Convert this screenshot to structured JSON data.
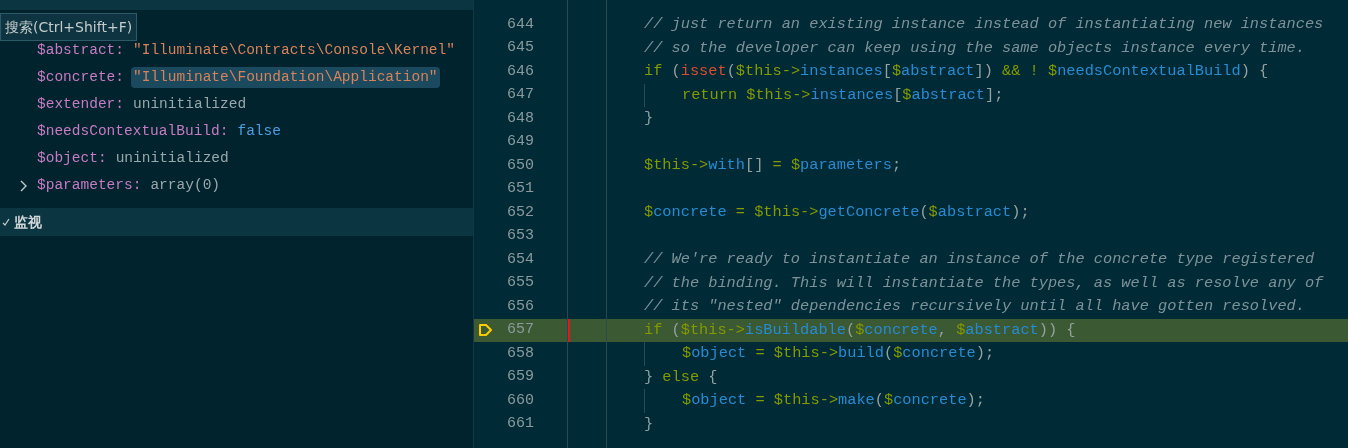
{
  "tooltip": {
    "text": "搜索(Ctrl+Shift+F)"
  },
  "variables": [
    {
      "name": "$abstract:",
      "value": "\"Illuminate\\Contracts\\Console\\Kernel\"",
      "kind": "string",
      "selected": false
    },
    {
      "name": "$concrete:",
      "value": "\"Illuminate\\Foundation\\Application\"",
      "kind": "string",
      "selected": true
    },
    {
      "name": "$extender:",
      "value": "uninitialized",
      "kind": "plain",
      "selected": false
    },
    {
      "name": "$needsContextualBuild:",
      "value": "false",
      "kind": "boolean",
      "selected": false
    },
    {
      "name": "$object:",
      "value": "uninitialized",
      "kind": "plain",
      "selected": false
    },
    {
      "name": "$parameters:",
      "value": "array(0)",
      "kind": "plain",
      "selected": false,
      "expanded": false
    }
  ],
  "watch_section": {
    "title": "监视",
    "expanded": true
  },
  "editor": {
    "lines": [
      {
        "number": "644",
        "nested": false,
        "current": false,
        "tokens": [
          {
            "kind": "comment",
            "text": "// just return an existing instance instead of instantiating new instances"
          }
        ]
      },
      {
        "number": "645",
        "nested": false,
        "current": false,
        "tokens": [
          {
            "kind": "comment",
            "text": "// so the developer can keep using the same objects instance every time."
          }
        ]
      },
      {
        "number": "646",
        "nested": false,
        "current": false,
        "tokens": [
          {
            "kind": "kw",
            "text": "if"
          },
          {
            "kind": "op",
            "text": " ("
          },
          {
            "kind": "builtin",
            "text": "isset"
          },
          {
            "kind": "op",
            "text": "("
          },
          {
            "kind": "kw",
            "text": "$this->"
          },
          {
            "kind": "fn",
            "text": "instances"
          },
          {
            "kind": "op",
            "text": "["
          },
          {
            "kind": "kw",
            "text": "$"
          },
          {
            "kind": "fn",
            "text": "abstract"
          },
          {
            "kind": "op",
            "text": "]) "
          },
          {
            "kind": "kw",
            "text": "&& ! $"
          },
          {
            "kind": "fn",
            "text": "needsContextualBuild"
          },
          {
            "kind": "op",
            "text": ") {"
          }
        ]
      },
      {
        "number": "647",
        "nested": true,
        "current": false,
        "tokens": [
          {
            "kind": "kw",
            "text": "return $this->"
          },
          {
            "kind": "fn",
            "text": "instances"
          },
          {
            "kind": "op",
            "text": "["
          },
          {
            "kind": "kw",
            "text": "$"
          },
          {
            "kind": "fn",
            "text": "abstract"
          },
          {
            "kind": "op",
            "text": "];"
          }
        ]
      },
      {
        "number": "648",
        "nested": false,
        "current": false,
        "tokens": [
          {
            "kind": "op",
            "text": "}"
          }
        ]
      },
      {
        "number": "649",
        "nested": false,
        "current": false
      },
      {
        "number": "650",
        "nested": false,
        "current": false,
        "tokens": [
          {
            "kind": "kw",
            "text": "$this->"
          },
          {
            "kind": "fn",
            "text": "with"
          },
          {
            "kind": "op",
            "text": "[] "
          },
          {
            "kind": "kw",
            "text": "= $"
          },
          {
            "kind": "fn",
            "text": "parameters"
          },
          {
            "kind": "op",
            "text": ";"
          }
        ]
      },
      {
        "number": "651",
        "nested": false,
        "current": false
      },
      {
        "number": "652",
        "nested": false,
        "current": false,
        "tokens": [
          {
            "kind": "kw",
            "text": "$"
          },
          {
            "kind": "fn",
            "text": "concrete"
          },
          {
            "kind": "kw",
            "text": " = $this->"
          },
          {
            "kind": "fn",
            "text": "getConcrete"
          },
          {
            "kind": "op",
            "text": "("
          },
          {
            "kind": "kw",
            "text": "$"
          },
          {
            "kind": "fn",
            "text": "abstract"
          },
          {
            "kind": "op",
            "text": ");"
          }
        ]
      },
      {
        "number": "653",
        "nested": false,
        "current": false
      },
      {
        "number": "654",
        "nested": false,
        "current": false,
        "tokens": [
          {
            "kind": "comment",
            "text": "// We're ready to instantiate an instance of the concrete type registered"
          }
        ]
      },
      {
        "number": "655",
        "nested": false,
        "current": false,
        "tokens": [
          {
            "kind": "comment",
            "text": "// the binding. This will instantiate the types, as well as resolve any of"
          }
        ]
      },
      {
        "number": "656",
        "nested": false,
        "current": false,
        "tokens": [
          {
            "kind": "comment",
            "text": "// its \"nested\" dependencies recursively until all have gotten resolved."
          }
        ]
      },
      {
        "number": "657",
        "nested": false,
        "current": true,
        "tokens": [
          {
            "kind": "kw",
            "text": "if"
          },
          {
            "kind": "op",
            "text": " ("
          },
          {
            "kind": "kw",
            "text": "$this->"
          },
          {
            "kind": "fn",
            "text": "isBuildable"
          },
          {
            "kind": "op",
            "text": "("
          },
          {
            "kind": "kw",
            "text": "$"
          },
          {
            "kind": "fn",
            "text": "concrete"
          },
          {
            "kind": "op",
            "text": ", "
          },
          {
            "kind": "kw",
            "text": "$"
          },
          {
            "kind": "fn",
            "text": "abstract"
          },
          {
            "kind": "op",
            "text": ")) {"
          }
        ]
      },
      {
        "number": "658",
        "nested": true,
        "current": false,
        "tokens": [
          {
            "kind": "kw",
            "text": "$"
          },
          {
            "kind": "fn",
            "text": "object"
          },
          {
            "kind": "kw",
            "text": " = $this->"
          },
          {
            "kind": "fn",
            "text": "build"
          },
          {
            "kind": "op",
            "text": "("
          },
          {
            "kind": "kw",
            "text": "$"
          },
          {
            "kind": "fn",
            "text": "concrete"
          },
          {
            "kind": "op",
            "text": ");"
          }
        ]
      },
      {
        "number": "659",
        "nested": false,
        "current": false,
        "tokens": [
          {
            "kind": "op",
            "text": "} "
          },
          {
            "kind": "kw",
            "text": "else"
          },
          {
            "kind": "op",
            "text": " {"
          }
        ]
      },
      {
        "number": "660",
        "nested": true,
        "current": false,
        "tokens": [
          {
            "kind": "kw",
            "text": "$"
          },
          {
            "kind": "fn",
            "text": "object"
          },
          {
            "kind": "kw",
            "text": " = $this->"
          },
          {
            "kind": "fn",
            "text": "make"
          },
          {
            "kind": "op",
            "text": "("
          },
          {
            "kind": "kw",
            "text": "$"
          },
          {
            "kind": "fn",
            "text": "concrete"
          },
          {
            "kind": "op",
            "text": ");"
          }
        ]
      },
      {
        "number": "661",
        "nested": false,
        "current": false,
        "tokens": [
          {
            "kind": "op",
            "text": "}"
          }
        ]
      }
    ]
  }
}
